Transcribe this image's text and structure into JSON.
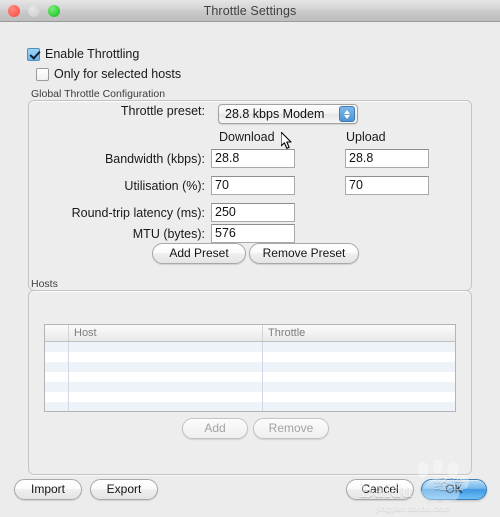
{
  "window": {
    "title": "Throttle Settings",
    "traffic_lights": [
      {
        "name": "close",
        "color": "#fb5b52"
      },
      {
        "name": "minimize",
        "color": "#d4d4d4"
      },
      {
        "name": "zoom",
        "color": "#2fcc34"
      }
    ]
  },
  "checkboxes": {
    "enable_throttling": {
      "label": "Enable Throttling",
      "checked": true
    },
    "only_selected_hosts": {
      "label": "Only for selected hosts",
      "checked": false
    }
  },
  "global_group": {
    "label": "Global Throttle Configuration",
    "preset": {
      "label": "Throttle preset:",
      "value": "28.8 kbps Modem"
    },
    "column_headers": {
      "download": "Download",
      "upload": "Upload"
    },
    "fields": [
      {
        "label": "Bandwidth (kbps):",
        "download": "28.8",
        "upload": "28.8",
        "two_columns": true
      },
      {
        "label": "Utilisation (%):",
        "download": "70",
        "upload": "70",
        "two_columns": true
      },
      {
        "label": "Round-trip latency (ms):",
        "download": "250",
        "upload": "",
        "two_columns": false
      },
      {
        "label": "MTU (bytes):",
        "download": "576",
        "upload": "",
        "two_columns": false
      }
    ],
    "buttons": {
      "add_preset": "Add Preset",
      "remove_preset": "Remove Preset"
    }
  },
  "hosts_group": {
    "label": "Hosts",
    "table": {
      "columns": [
        "",
        "Host",
        "Throttle"
      ],
      "rows": [
        [
          "",
          "",
          ""
        ],
        [
          "",
          "",
          ""
        ],
        [
          "",
          "",
          ""
        ],
        [
          "",
          "",
          ""
        ],
        [
          "",
          "",
          ""
        ],
        [
          "",
          "",
          ""
        ],
        [
          "",
          "",
          ""
        ]
      ]
    },
    "buttons": {
      "add": "Add",
      "remove": "Remove",
      "add_enabled": false,
      "remove_enabled": false
    }
  },
  "footer": {
    "import": "Import",
    "export": "Export",
    "cancel": "Cancel",
    "ok": "OK"
  },
  "watermark": {
    "brand": "Baidu",
    "cn": "经验",
    "sub": "jingyan.baidu.com"
  },
  "colors": {
    "window_bg": "#ececec",
    "accent_blue": "#4f94d4",
    "row_stripe": "#eef3fa",
    "checkbox_checked": "#6fb9ee"
  }
}
